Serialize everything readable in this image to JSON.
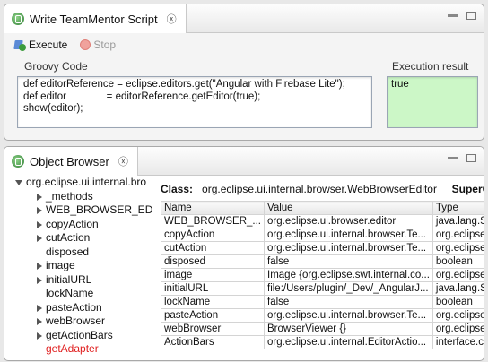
{
  "top_view": {
    "tab_title": "Write TeamMentor Script",
    "close_glyph": "ⓧ",
    "toolbar": {
      "execute_label": "Execute",
      "stop_label": "Stop"
    },
    "code_label": "Groovy Code",
    "result_label": "Execution result",
    "code": "def editorReference = eclipse.editors.get(\"Angular with Firebase Lite\");\ndef editor              = editorReference.getEditor(true);\nshow(editor);",
    "result": "true"
  },
  "bottom_view": {
    "tab_title": "Object Browser",
    "close_glyph": "ⓧ",
    "tree": {
      "root": "org.eclipse.ui.internal.bro",
      "items": [
        {
          "label": "_methods",
          "expandable": true
        },
        {
          "label": "WEB_BROWSER_EDITOR",
          "expandable": true
        },
        {
          "label": "copyAction",
          "expandable": true
        },
        {
          "label": "cutAction",
          "expandable": true
        },
        {
          "label": "disposed",
          "expandable": false
        },
        {
          "label": "image",
          "expandable": true
        },
        {
          "label": "initialURL",
          "expandable": true
        },
        {
          "label": "lockName",
          "expandable": false
        },
        {
          "label": "pasteAction",
          "expandable": true
        },
        {
          "label": "webBrowser",
          "expandable": true
        },
        {
          "label": "getActionBars",
          "expandable": true
        },
        {
          "label": "getAdapter",
          "expandable": false,
          "highlight": true
        }
      ]
    },
    "class_label": "Class:",
    "class_name": "org.eclipse.ui.internal.browser.WebBrowserEditor",
    "super_label": "SuperC",
    "columns": [
      "Name",
      "Value",
      "Type"
    ],
    "rows": [
      [
        "WEB_BROWSER_...",
        "org.eclipse.ui.browser.editor",
        "java.lang.S"
      ],
      [
        "copyAction",
        "org.eclipse.ui.internal.browser.Te...",
        "org.eclipse"
      ],
      [
        "cutAction",
        "org.eclipse.ui.internal.browser.Te...",
        "org.eclipse"
      ],
      [
        "disposed",
        "false",
        "boolean"
      ],
      [
        "image",
        "Image {org.eclipse.swt.internal.co...",
        "org.eclipse"
      ],
      [
        "initialURL",
        "file:/Users/plugin/_Dev/_AngularJ...",
        "java.lang.S"
      ],
      [
        "lockName",
        "false",
        "boolean"
      ],
      [
        "pasteAction",
        "org.eclipse.ui.internal.browser.Te...",
        "org.eclipse"
      ],
      [
        "webBrowser",
        "BrowserViewer {}",
        "org.eclipse"
      ],
      [
        "ActionBars",
        "org.eclipse.ui.internal.EditorActio...",
        "interface.c"
      ]
    ]
  },
  "colors": {
    "result_bg": "#ccf7c7",
    "highlight_text": "#e02020"
  }
}
